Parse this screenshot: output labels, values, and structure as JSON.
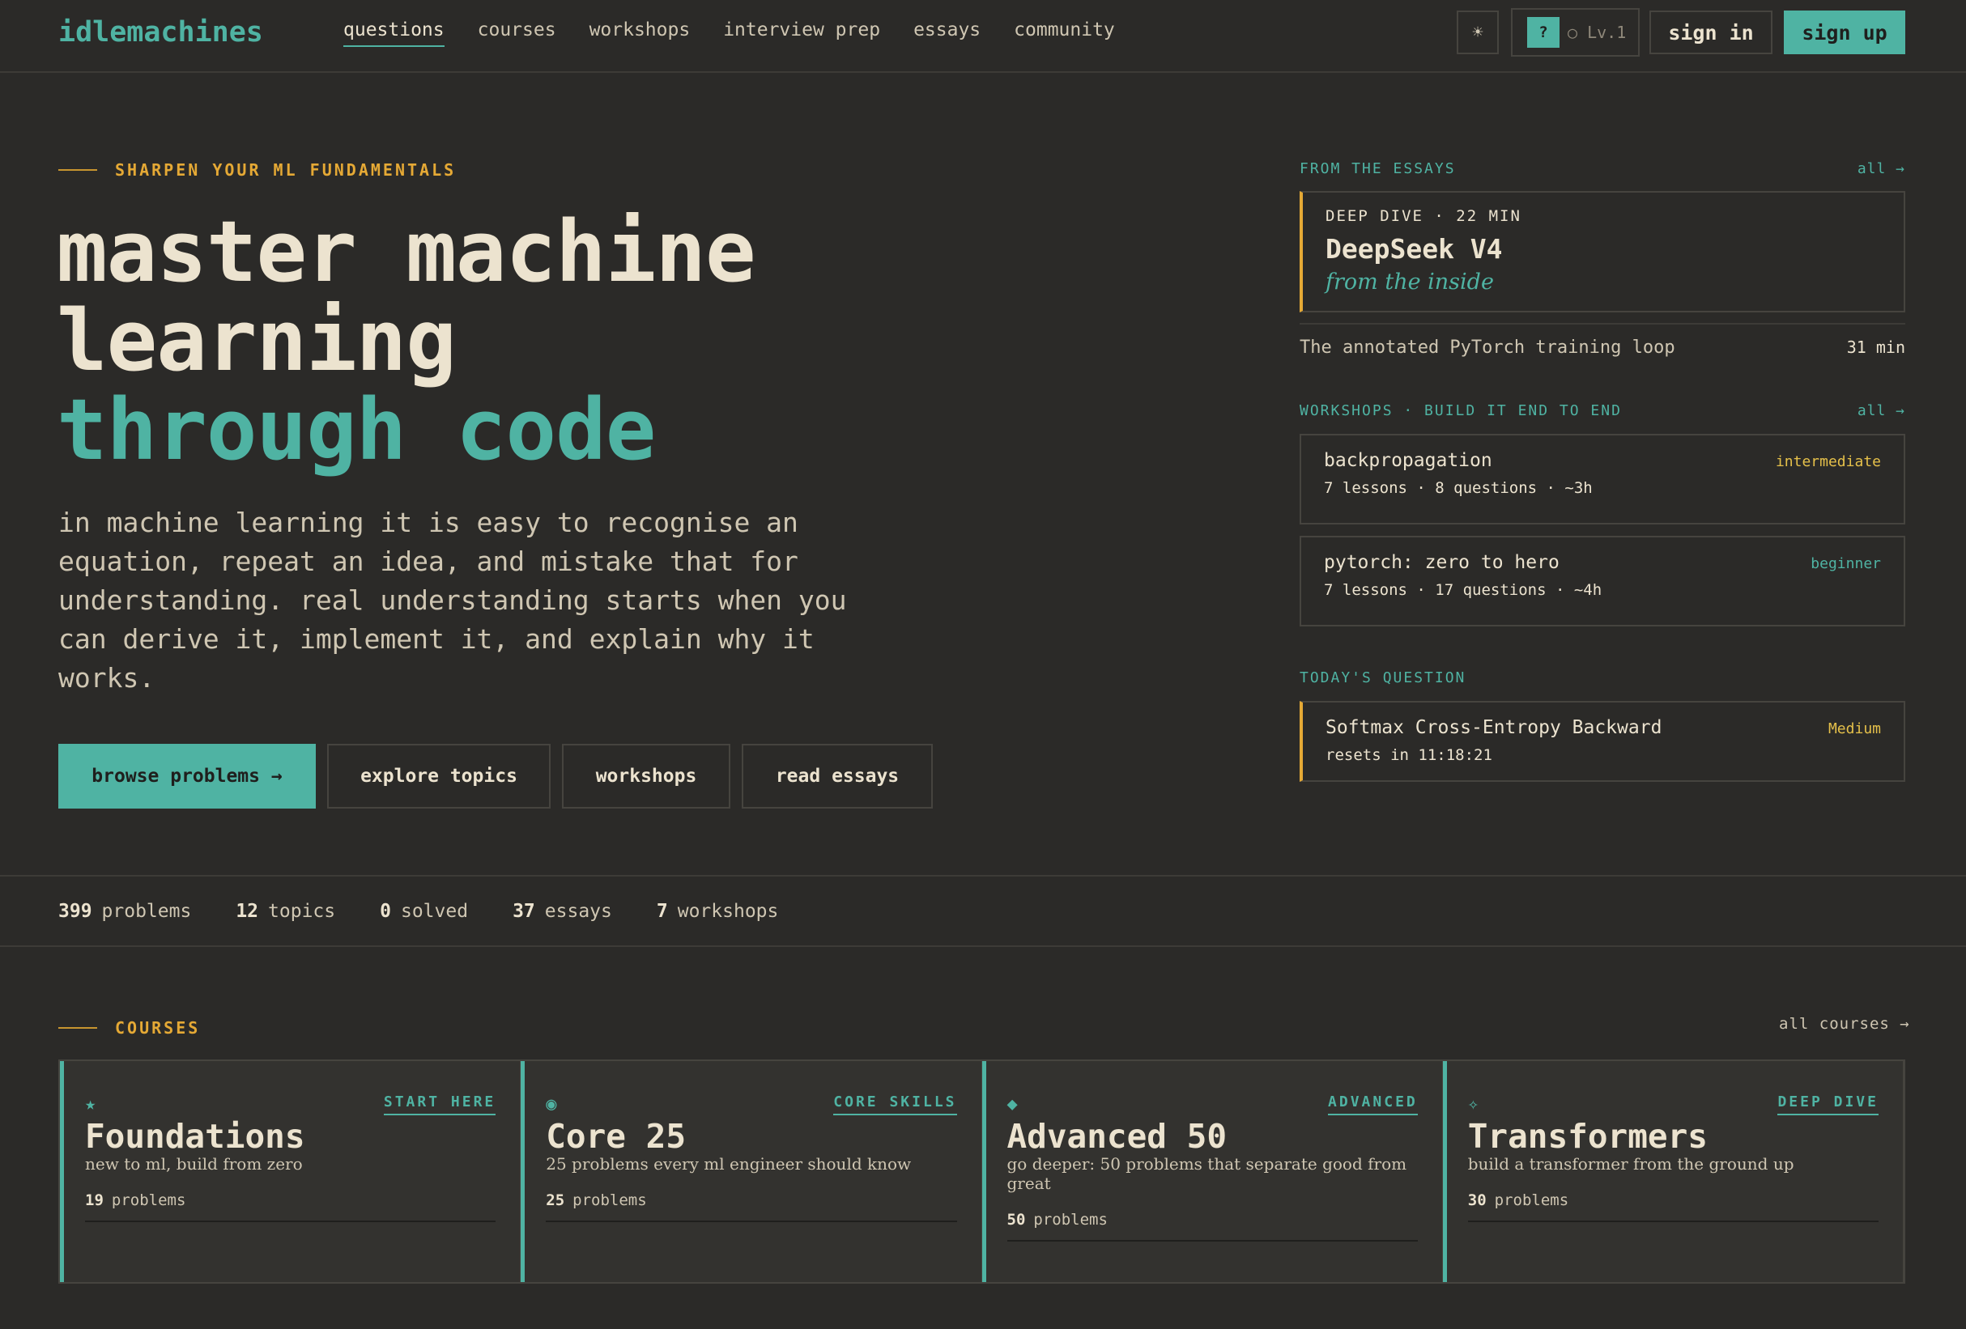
{
  "nav": {
    "logo": "idlemachines",
    "links": [
      {
        "label": "questions",
        "active": true
      },
      {
        "label": "courses"
      },
      {
        "label": "workshops"
      },
      {
        "label": "interview prep"
      },
      {
        "label": "essays"
      },
      {
        "label": "community"
      }
    ],
    "theme_icon": "sun-icon",
    "level_badge": "?",
    "level_text": "○ Lv.1",
    "sign_in": "sign in",
    "sign_up": "sign up"
  },
  "hero": {
    "eyebrow": "SHARPEN YOUR ML FUNDAMENTALS",
    "title_line1": "master machine",
    "title_line2": "learning",
    "title_line3": "through code",
    "description": "in machine learning it is easy to recognise an equation, repeat an idea, and mistake that for understanding. real understanding starts when you can derive it, implement it, and explain why it works.",
    "ctas": [
      "browse problems →",
      "explore topics",
      "workshops",
      "read essays"
    ]
  },
  "essays": {
    "heading": "FROM THE ESSAYS",
    "all": "all →",
    "featured": {
      "meta": "DEEP DIVE · 22 MIN",
      "title": "DeepSeek V4",
      "subtitle": "from the inside"
    },
    "more": [
      {
        "title": "The annotated PyTorch training loop",
        "duration": "31 min"
      }
    ]
  },
  "workshops": {
    "heading": "WORKSHOPS · BUILD IT END TO END",
    "all": "all →",
    "items": [
      {
        "title": "backpropagation",
        "meta": "7 lessons · 8 questions · ~3h",
        "level": "intermediate"
      },
      {
        "title": "pytorch: zero to hero",
        "meta": "7 lessons · 17 questions · ~4h",
        "level": "beginner"
      }
    ]
  },
  "todays_question": {
    "heading": "TODAY'S QUESTION",
    "title": "Softmax Cross-Entropy Backward",
    "difficulty": "Medium",
    "resets": "resets in 11:18:21"
  },
  "stats": [
    {
      "value": "399",
      "label": "problems"
    },
    {
      "value": "12",
      "label": "topics"
    },
    {
      "value": "0",
      "label": "solved"
    },
    {
      "value": "37",
      "label": "essays"
    },
    {
      "value": "7",
      "label": "workshops"
    }
  ],
  "courses": {
    "eyebrow": "COURSES",
    "all": "all courses →",
    "items": [
      {
        "icon": "★",
        "tag": "START HERE",
        "name": "Foundations",
        "desc": "new to ml, build from zero",
        "count": "19",
        "unit": "problems"
      },
      {
        "icon": "◉",
        "tag": "CORE SKILLS",
        "name": "Core 25",
        "desc": "25 problems every ml engineer should know",
        "count": "25",
        "unit": "problems"
      },
      {
        "icon": "◆",
        "tag": "ADVANCED",
        "name": "Advanced 50",
        "desc": "go deeper: 50 problems that separate good from great",
        "count": "50",
        "unit": "problems"
      },
      {
        "icon": "✧",
        "tag": "DEEP DIVE",
        "name": "Transformers",
        "desc": "build a transformer from the ground up",
        "count": "30",
        "unit": "problems"
      }
    ]
  },
  "colors": {
    "accent": "#4fb3a3",
    "highlight": "#e5a935",
    "level_intermediate": "#e5c04a",
    "level_beginner": "#4fb3a3",
    "difficulty_medium": "#e5c04a"
  }
}
